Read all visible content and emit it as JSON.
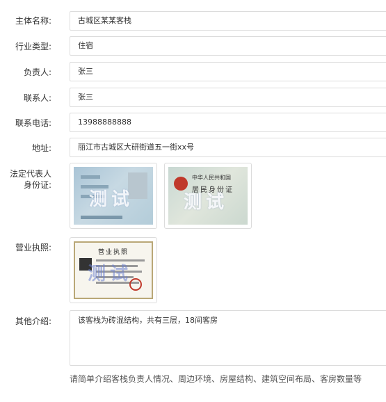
{
  "form": {
    "entity_name": {
      "label": "主体名称:",
      "value": "古城区某某客栈"
    },
    "industry_type": {
      "label": "行业类型:",
      "value": "住宿"
    },
    "person_in_charge": {
      "label": "负责人:",
      "value": "张三"
    },
    "contact_person": {
      "label": "联系人:",
      "value": "张三"
    },
    "contact_phone": {
      "label": "联系电话:",
      "value": "13988888888"
    },
    "address": {
      "label": "地址:",
      "value": "丽江市古城区大研街道五一街xx号"
    },
    "id_card": {
      "label_line1": "法定代表人",
      "label_line2": "身份证:",
      "front_watermark": "测试",
      "back_watermark": "测试",
      "back_title": "中华人民共和国",
      "back_subtitle": "居民身份证"
    },
    "business_license": {
      "label": "营业执照:",
      "title": "营业执照",
      "watermark": "测试"
    },
    "other_intro": {
      "label": "其他介绍:",
      "value": "该客栈为砖混结构，共有三层，18间客房",
      "hint": "请简单介绍客栈负责人情况、周边环境、房屋结构、建筑空间布局、客房数量等"
    }
  }
}
